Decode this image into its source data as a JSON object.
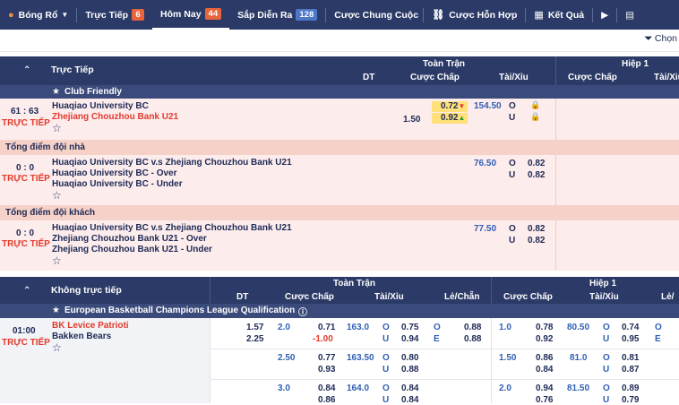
{
  "nav": {
    "sport": "Bóng Rổ",
    "live_label": "Trực Tiếp",
    "live_count": "6",
    "today_label": "Hôm Nay",
    "today_count": "44",
    "upcoming_label": "Sắp Diễn Ra",
    "upcoming_count": "128",
    "outright_label": "Cược Chung Cuộc",
    "parlay_label": "Cược Hỗn Hợp",
    "results_label": "Kết Quả"
  },
  "filter": {
    "label": "Chọn"
  },
  "live_section": {
    "title": "Trực Tiếp",
    "full_time": "Toàn Trận",
    "half1": "Hiệp 1",
    "col_dt": "DT",
    "col_handicap": "Cược Chấp",
    "col_ou": "Tài/Xỉu",
    "col_handicap2": "Cược Chấp",
    "col_ou2": "Tài/Xiu",
    "league": "Club Friendly",
    "match": {
      "score": "61 : 63",
      "status": "TRỰC TIẾP",
      "home": "Huaqiao University BC",
      "away": "Zhejiang Chouzhou Bank U21",
      "hcp_line": "1.50",
      "hcp_home": "0.72",
      "hcp_away": "0.92",
      "ou_line": "154.50",
      "ou_o": "O",
      "ou_u": "U"
    },
    "home_total": {
      "title": "Tổng điểm đội nhà",
      "score": "0 : 0",
      "status": "TRỰC TIẾP",
      "line1": "Huaqiao University BC v.s Zhejiang Chouzhou Bank U21",
      "line2": "Huaqiao University BC - Over",
      "line3": "Huaqiao University BC - Under",
      "ou_line": "76.50",
      "o": "O",
      "u": "U",
      "o_odds": "0.82",
      "u_odds": "0.82"
    },
    "away_total": {
      "title": "Tổng điểm đội khách",
      "score": "0 : 0",
      "status": "TRỰC TIẾP",
      "line1": "Huaqiao University BC v.s Zhejiang Chouzhou Bank U21",
      "line2": "Zhejiang Chouzhou Bank U21 - Over",
      "line3": "Zhejiang Chouzhou Bank U21 - Under",
      "ou_line": "77.50",
      "o": "O",
      "u": "U",
      "o_odds": "0.82",
      "u_odds": "0.82"
    }
  },
  "prematch_section": {
    "title": "Không trực tiếp",
    "full_time": "Toàn Trận",
    "half1": "Hiệp 1",
    "col_dt": "DT",
    "col_handicap": "Cược Chấp",
    "col_ou": "Tài/Xỉu",
    "col_oe": "Lẻ/Chẵn",
    "col_handicap2": "Cược Chấp",
    "col_ou2": "Tài/Xỉu",
    "col_oe2": "Lẻ/",
    "league": "European Basketball Champions League Qualification",
    "match": {
      "time": "01:00",
      "status": "TRỰC TIẾP",
      "home": "BK Levice Patrioti",
      "away": "Bakken Bears",
      "dt_home": "1.57",
      "dt_away": "2.25"
    },
    "rows": [
      {
        "hcp": "2.0",
        "hcp_h": "0.71",
        "hcp_a": "-1.00",
        "ou": "163.0",
        "ou_o": "0.75",
        "ou_u": "0.94",
        "oe_o": "0.88",
        "oe_e": "0.88",
        "h1_hcp": "1.0",
        "h1_h": "0.78",
        "h1_a": "0.92",
        "h1_ou": "80.50",
        "h1_o": "0.74",
        "h1_u": "0.95"
      },
      {
        "hcp": "2.50",
        "hcp_h": "0.77",
        "hcp_a": "0.93",
        "ou": "163.50",
        "ou_o": "0.80",
        "ou_u": "0.88",
        "h1_hcp": "1.50",
        "h1_h": "0.86",
        "h1_a": "0.84",
        "h1_ou": "81.0",
        "h1_o": "0.81",
        "h1_u": "0.87"
      },
      {
        "hcp": "3.0",
        "hcp_h": "0.84",
        "hcp_a": "0.86",
        "ou": "164.0",
        "ou_o": "0.84",
        "ou_u": "0.84",
        "h1_hcp": "2.0",
        "h1_h": "0.94",
        "h1_a": "0.76",
        "h1_ou": "81.50",
        "h1_o": "0.89",
        "h1_u": "0.79"
      }
    ],
    "o": "O",
    "u": "U",
    "e": "E"
  }
}
